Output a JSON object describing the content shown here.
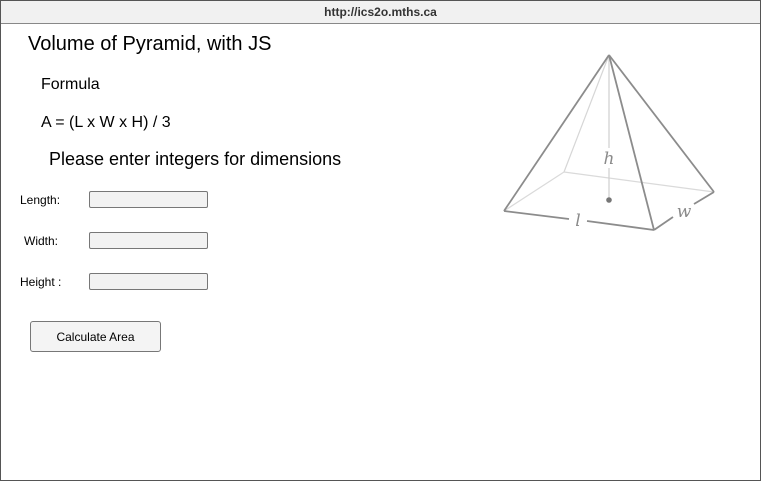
{
  "window": {
    "url": "http://ics2o.mths.ca"
  },
  "page": {
    "title": "Volume of Pyramid, with JS",
    "formula_heading": "Formula",
    "formula": "A = (L x W x H) / 3",
    "instructions": "Please enter integers for dimensions"
  },
  "form": {
    "length_label": "Length:",
    "length_value": "",
    "width_label": "Width:",
    "width_value": "",
    "height_label": "Height :",
    "height_value": "",
    "button_label": "Calculate Area"
  },
  "diagram": {
    "height_symbol": "h",
    "length_symbol": "l",
    "width_symbol": "w"
  }
}
